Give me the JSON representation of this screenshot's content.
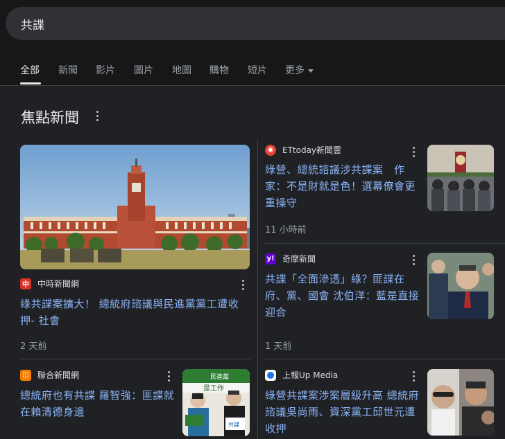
{
  "search": {
    "query": "共諜"
  },
  "tabs": [
    {
      "label": "全部",
      "active": true
    },
    {
      "label": "新聞"
    },
    {
      "label": "影片"
    },
    {
      "label": "圖片"
    },
    {
      "label": "地圖"
    },
    {
      "label": "購物"
    },
    {
      "label": "短片"
    },
    {
      "label": "更多"
    }
  ],
  "section": {
    "title": "焦點新聞"
  },
  "stories": [
    {
      "source": "中時新聞網",
      "headline": "綠共諜案擴大！ 總統府諮議與民進黨黨工遭收押- 社會",
      "time": "2 天前",
      "logo_color": "#d93025",
      "icon": "chinatimes-logo-icon"
    },
    {
      "source": "ETtoday新聞雲",
      "headline": "綠營、總統諮議涉共諜案　作家：不是財就是色！選幕僚會更重操守",
      "time": "11 小時前",
      "logo_color": "#ea4335",
      "icon": "ettoday-logo-icon"
    },
    {
      "source": "奇摩新聞",
      "headline": "共諜「全面滲透」綠？匪諜在府、黨、國會 沈伯洋：藍是直接迎合",
      "time": "1 天前",
      "logo_color": "#6001d2",
      "icon": "yahoo-logo-icon"
    },
    {
      "source": "聯合新聞網",
      "headline": "總統府也有共諜 羅智強：匪諜就在賴清德身邊",
      "logo_color": "#f57c00",
      "icon": "udn-logo-icon"
    },
    {
      "source": "上報Up Media",
      "headline": "綠營共諜案涉案層級升高 總統府諮議吳尚雨、資深黨工邱世元遭收押",
      "logo_color": "#1a73e8",
      "icon": "upmedia-logo-icon"
    }
  ],
  "thumbs": {
    "udn_sign_1": "民進黨",
    "udn_sign_2": "是工作",
    "udn_sign_3": "共諜"
  }
}
